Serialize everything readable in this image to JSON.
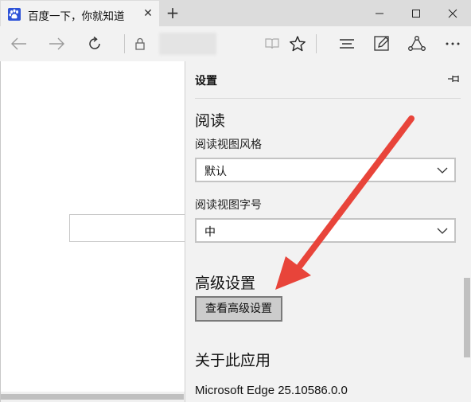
{
  "tab": {
    "title": "百度一下，你就知道",
    "favicon": "baidu-paw-icon",
    "close_glyph": "✕"
  },
  "new_tab_glyph": "+",
  "window_controls": [
    "minimize-icon",
    "maximize-icon",
    "close-icon"
  ],
  "toolbar": {
    "back_icon": "back-arrow-icon",
    "forward_icon": "forward-arrow-icon",
    "refresh_icon": "refresh-icon",
    "lock_icon": "lock-icon",
    "address": "",
    "reading_view_icon": "reading-view-icon",
    "favorites_icon": "star-icon",
    "hub_icon": "hub-icon",
    "note_icon": "web-note-icon",
    "share_icon": "share-icon",
    "more_icon": "more-icon"
  },
  "settings": {
    "title": "设置",
    "pin_icon": "pin-icon",
    "reading": {
      "heading": "阅读",
      "style_label": "阅读视图风格",
      "style_value": "默认",
      "font_label": "阅读视图字号",
      "font_value": "中"
    },
    "advanced": {
      "heading": "高级设置",
      "button_label": "查看高级设置"
    },
    "about": {
      "heading": "关于此应用",
      "version": "Microsoft Edge 25.10586.0.0"
    }
  },
  "colors": {
    "annotation_arrow": "#e8443a",
    "favicon_bg": "#2f54d8"
  }
}
